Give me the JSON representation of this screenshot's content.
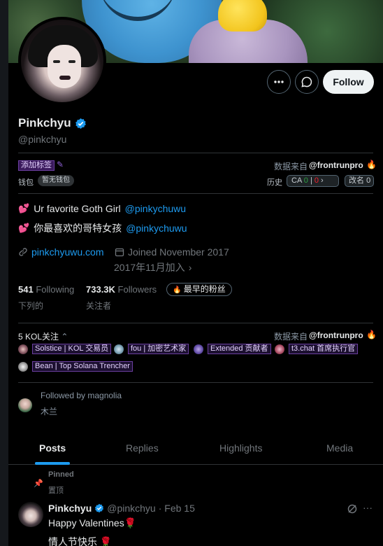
{
  "profile": {
    "name": "Pinkchyu",
    "handle": "@pinkchyu",
    "follow_label": "Follow"
  },
  "tags": {
    "add_tag": "添加标签",
    "source_label": "数据来自",
    "source_value": "@frontrunpro",
    "wallet_label": "钱包",
    "wallet_value": "暂无钱包",
    "history_label": "历史",
    "ca_label": "CA",
    "ca_green": "0",
    "ca_sep": "|",
    "ca_red": "0",
    "rename_label": "改名",
    "rename_value": "0"
  },
  "bio": {
    "line1_text": "Ur favorite Goth Girl",
    "line1_link": "@pinkychuwu",
    "line2_text": "你最喜欢的哥特女孩",
    "line2_link": "@pinkychuwu"
  },
  "meta": {
    "website": "pinkchyuwu.com",
    "joined": "Joined November 2017",
    "joined_cn": "2017年11月加入"
  },
  "stats": {
    "following_count": "541",
    "following_label": "Following",
    "following_cn": "下列的",
    "followers_count": "733.3K",
    "followers_label": "Followers",
    "followers_cn": "关注者",
    "early_label": "最早的粉丝"
  },
  "kol": {
    "title": "5 KOL关注",
    "source_label": "数据来自",
    "source_value": "@frontrunpro",
    "items": [
      {
        "label": "Solstice | KOL 交易员"
      },
      {
        "label": "fou | 加密艺术家"
      },
      {
        "label": "Extended 贡献者"
      },
      {
        "label": "t3.chat 首席执行官"
      },
      {
        "label": "Bean | Top Solana Trencher"
      }
    ]
  },
  "followed_by": {
    "text": "Followed by magnolia",
    "sub": "木兰"
  },
  "tabs": [
    {
      "label": "Posts"
    },
    {
      "label": "Replies"
    },
    {
      "label": "Highlights"
    },
    {
      "label": "Media"
    }
  ],
  "post": {
    "pinned": "Pinned",
    "pinned_cn": "置顶",
    "name": "Pinkchyu",
    "handle": "@pinkchyu",
    "date": "· Feb 15",
    "line1": "Happy Valentines",
    "line2": "情人节快乐"
  },
  "colors": {
    "accent": "#1d9bf0",
    "tag_purple": "#6b3fa0",
    "verified": "#1d9bf0"
  },
  "icons": [
    "more-icon",
    "message-icon",
    "verified-icon",
    "pencil-icon",
    "fire-icon",
    "link-icon",
    "calendar-icon",
    "chevron-right-icon",
    "chevron-up-icon",
    "pin-icon",
    "grok-icon",
    "heart-icon",
    "rose-icon"
  ]
}
